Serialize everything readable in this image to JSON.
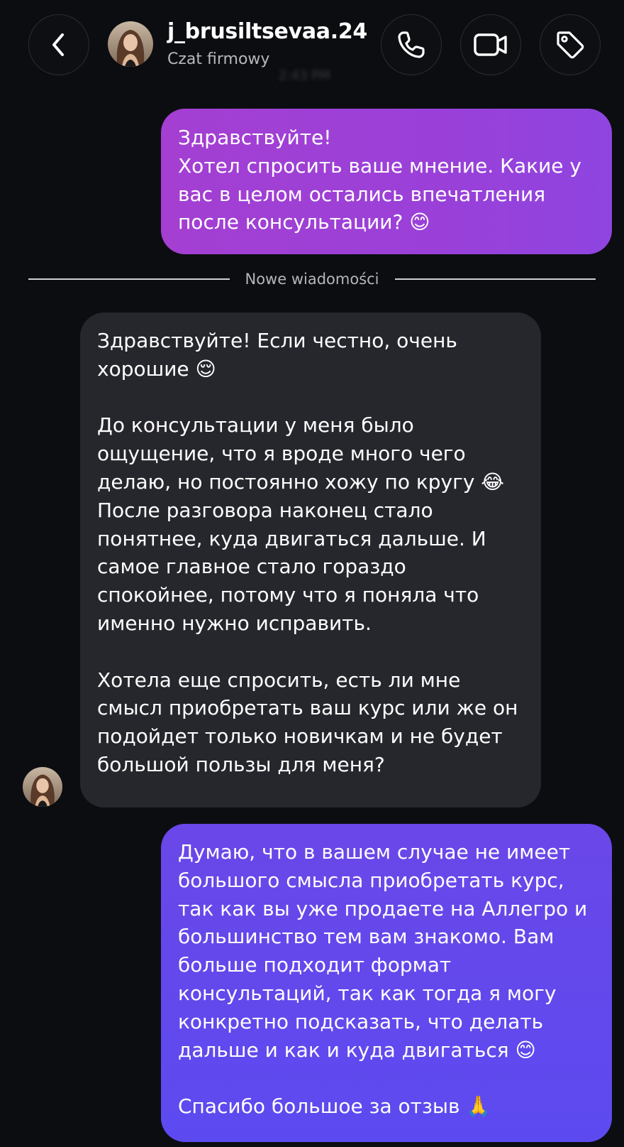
{
  "header": {
    "back_icon": "chevron-left-icon",
    "contact_name": "j_brusiltsevaa.24",
    "contact_subtitle": "Czat firmowy",
    "timestamp": "2:43 PM",
    "actions": [
      {
        "icon": "phone-icon"
      },
      {
        "icon": "video-camera-icon"
      },
      {
        "icon": "tag-icon"
      }
    ]
  },
  "divider": {
    "label": "Nowe wiadomości"
  },
  "messages": [
    {
      "direction": "outgoing",
      "text": "Здравствуйте!\nХотел спросить ваше мнение. Какие у вас в целом остались впечатления после консультации? 😊"
    },
    {
      "direction": "incoming",
      "text": "Здравствуйте! Если честно, очень хорошие 😌\n\nДо консультации у меня было ощущение, что я вроде много чего делаю, но постоянно хожу по кругу 😂\nПосле разговора наконец стало понятнее, куда двигаться дальше. И самое главное стало гораздо спокойнее, потому что я поняла что именно нужно исправить.\n\nХотела еще спросить, есть ли мне смысл приобретать ваш курс или же он подойдет только новичкам и не будет большой пользы для меня?"
    },
    {
      "direction": "outgoing",
      "text": "Думаю, что в вашем случае не имеет большого смысла приобретать курс, так как вы уже продаете на Аллегро и большинство тем вам знакомо. Вам больше подходит формат консультаций, так как тогда я могу конкретно подсказать, что делать дальше и как и куда двигаться 😊\n\nСпасибо большое за отзыв 🙏"
    }
  ],
  "colors": {
    "background": "#0c0d11",
    "incoming_bubble": "#26272d",
    "outgoing_bubble_1": "#9a40d8",
    "outgoing_bubble_2": "#5c4af0"
  }
}
